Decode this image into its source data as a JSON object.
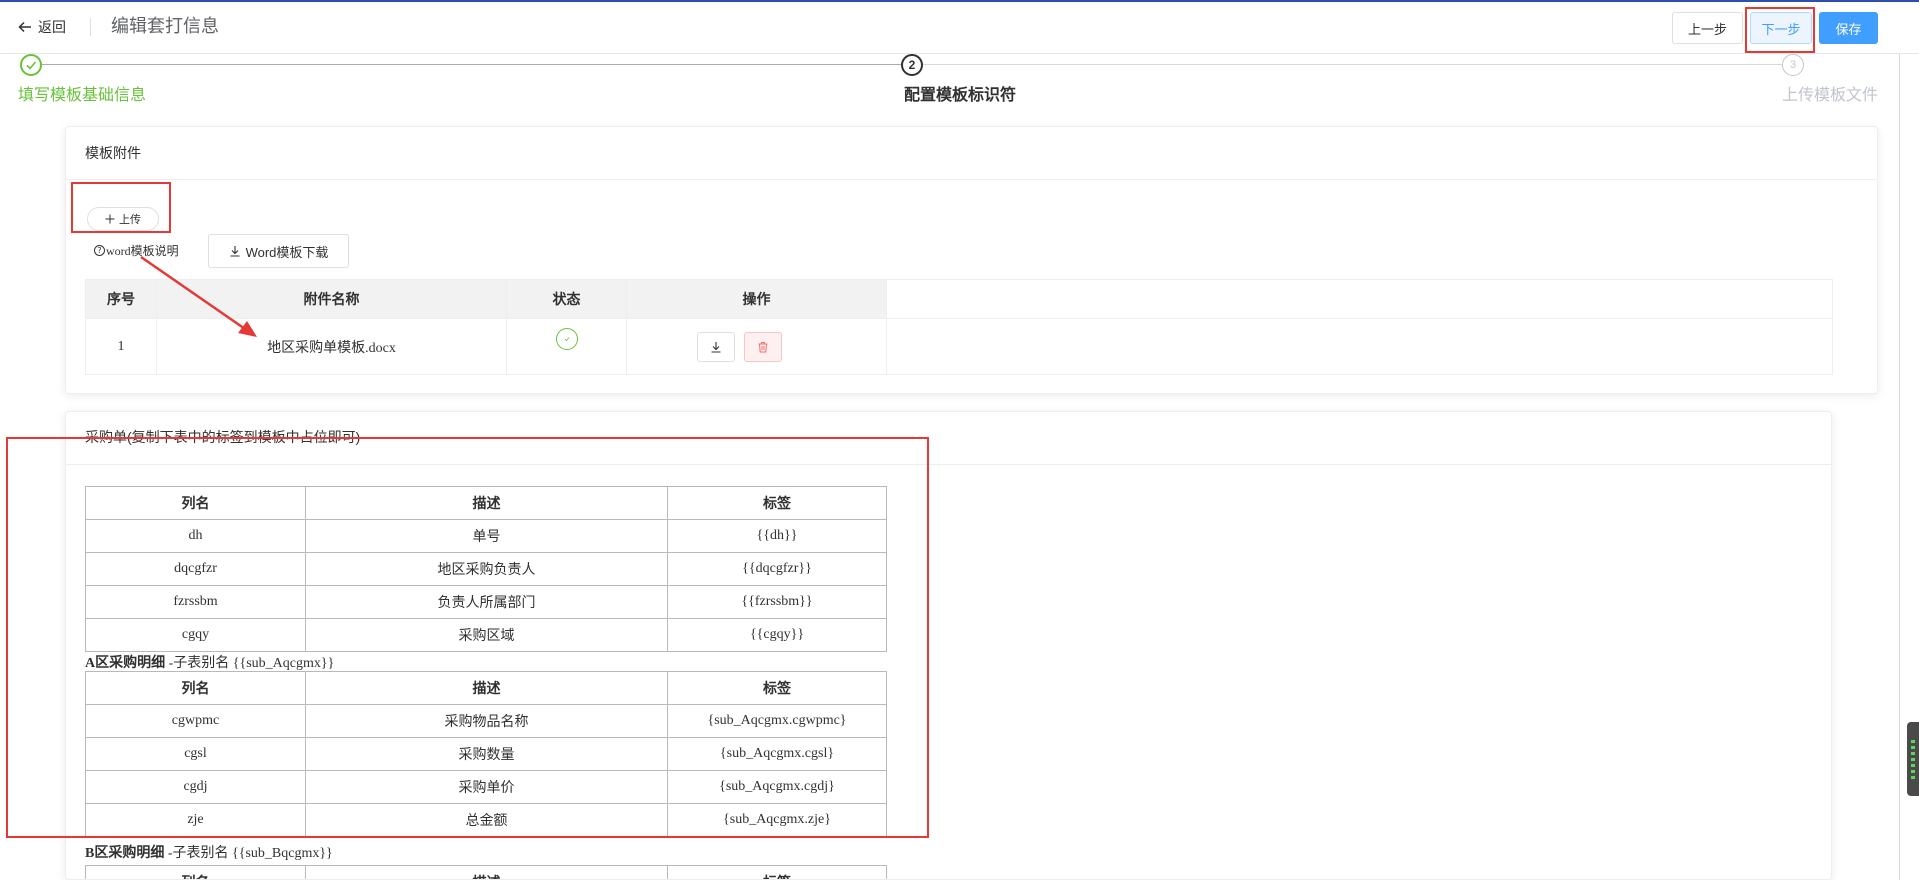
{
  "header": {
    "back_label": "返回",
    "title": "编辑套打信息",
    "prev_label": "上一步",
    "next_label": "下一步",
    "save_label": "保存"
  },
  "steps": [
    {
      "number": "",
      "label": "填写模板基础信息",
      "status": "done"
    },
    {
      "number": "2",
      "label": "配置模板标识符",
      "status": "current"
    },
    {
      "number": "3",
      "label": "上传模板文件",
      "status": "pending"
    }
  ],
  "attachments": {
    "title": "模板附件",
    "upload_label": "上传",
    "help_label": "word模板说明",
    "download_label": "Word模板下载",
    "columns": [
      "序号",
      "附件名称",
      "状态",
      "操作"
    ],
    "rows": [
      {
        "index": "1",
        "name": "地区采购单模板.docx",
        "status": "success"
      }
    ]
  },
  "purchase": {
    "title": "采购单(复制下表中的标签到模板中占位即可)",
    "columns": [
      "列名",
      "描述",
      "标签"
    ],
    "main_rows": [
      [
        "dh",
        "单号",
        "{{dh}}"
      ],
      [
        "dqcgfzr",
        "地区采购负责人",
        "{{dqcgfzr}}"
      ],
      [
        "fzrssbm",
        "负责人所属部门",
        "{{fzrssbm}}"
      ],
      [
        "cgqy",
        "采购区域",
        "{{cgqy}}"
      ]
    ],
    "sub_tables": [
      {
        "name": "A区采购明细",
        "alias": "-子表别名 {{sub_Aqcgmx}}",
        "rows": [
          [
            "cgwpmc",
            "采购物品名称",
            "{sub_Aqcgmx.cgwpmc}"
          ],
          [
            "cgsl",
            "采购数量",
            "{sub_Aqcgmx.cgsl}"
          ],
          [
            "cgdj",
            "采购单价",
            "{sub_Aqcgmx.cgdj}"
          ],
          [
            "zje",
            "总金额",
            "{sub_Aqcgmx.zje}"
          ]
        ]
      },
      {
        "name": "B区采购明细",
        "alias": "-子表别名 {{sub_Bqcgmx}}",
        "rows": []
      }
    ]
  },
  "icons": {
    "back": "arrow-left-icon",
    "upload": "plus-icon",
    "help": "question-circle-icon",
    "download": "download-icon",
    "delete": "trash-icon",
    "done_step": "check-icon",
    "status": "success-circle-icon"
  },
  "colors": {
    "primary": "#409eff",
    "success": "#67c23a",
    "danger": "#f56c6c",
    "annotation": "#e53935",
    "topbar_accent": "#2f4fb0"
  }
}
